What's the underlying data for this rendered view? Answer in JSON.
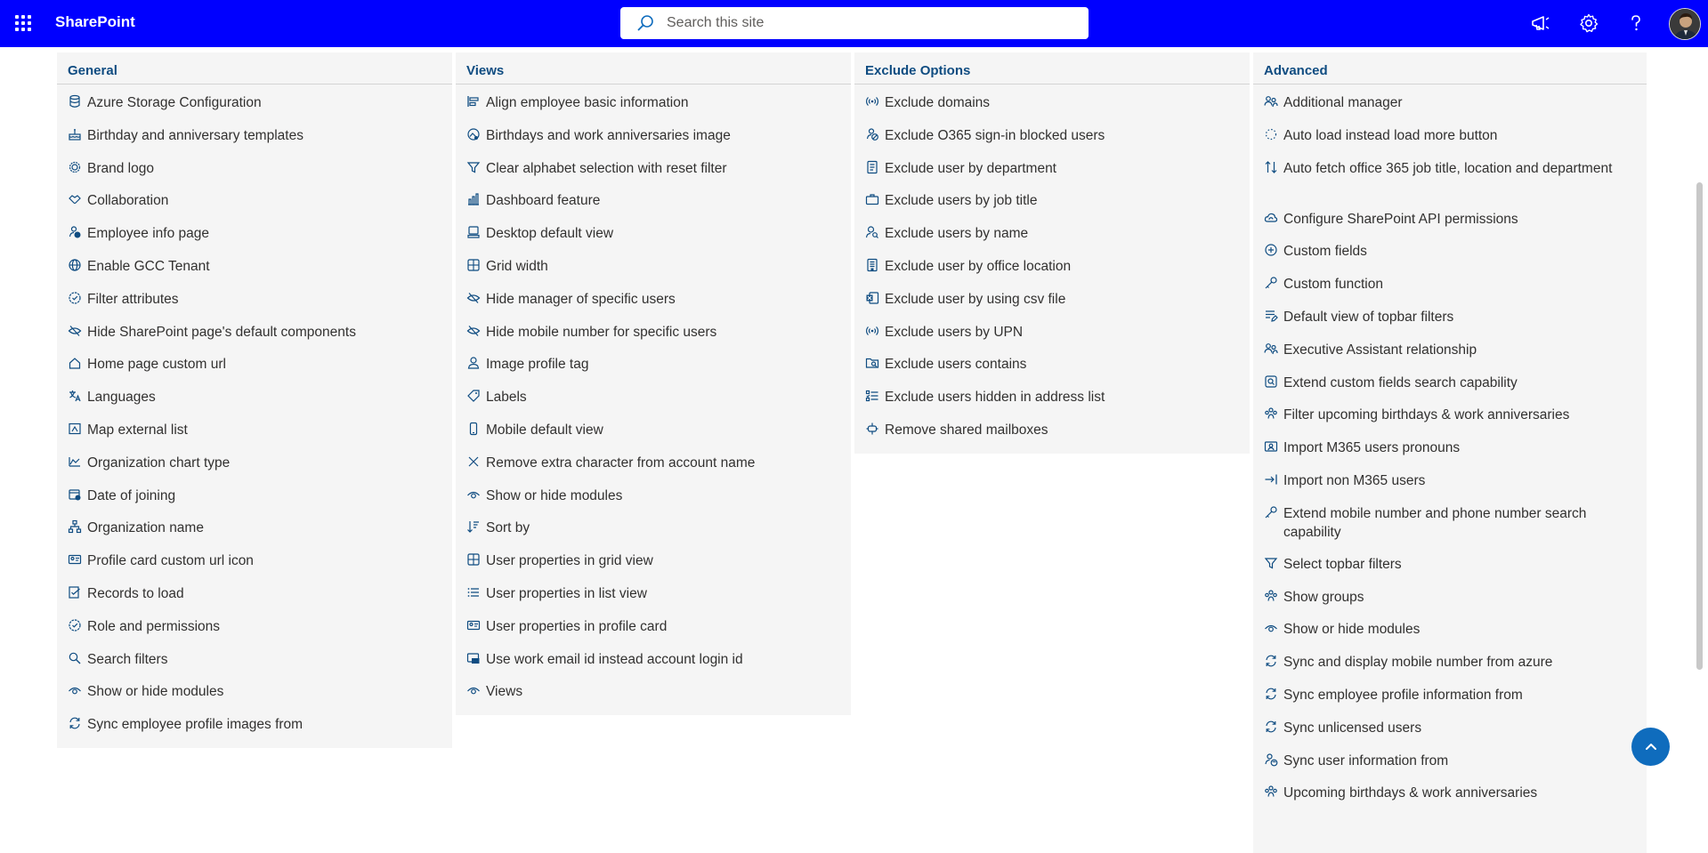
{
  "app": {
    "brand": "SharePoint"
  },
  "search": {
    "placeholder": "Search this site"
  },
  "columns": [
    {
      "title": "General",
      "items": [
        {
          "label": "Azure Storage Configuration",
          "icon": "database-icon"
        },
        {
          "label": "Birthday and anniversary templates",
          "icon": "cake-icon"
        },
        {
          "label": "Brand logo",
          "icon": "badge-icon"
        },
        {
          "label": "Collaboration",
          "icon": "handshake-icon"
        },
        {
          "label": "Employee info page",
          "icon": "person-info-icon"
        },
        {
          "label": "Enable GCC Tenant",
          "icon": "globe-icon"
        },
        {
          "label": "Filter attributes",
          "icon": "badge-check-icon"
        },
        {
          "label": "Hide SharePoint page's default components",
          "icon": "eye-hide-icon"
        },
        {
          "label": "Home page custom url",
          "icon": "home-icon"
        },
        {
          "label": "Languages",
          "icon": "translate-icon"
        },
        {
          "label": "Map external list",
          "icon": "map-list-icon"
        },
        {
          "label": "Organization chart type",
          "icon": "area-chart-icon"
        },
        {
          "label": "Date of joining",
          "icon": "calendar-icon"
        },
        {
          "label": "Organization name",
          "icon": "org-chart-icon"
        },
        {
          "label": "Profile card custom url icon",
          "icon": "contact-card-icon"
        },
        {
          "label": "Records to load",
          "icon": "checklist-icon"
        },
        {
          "label": "Role and permissions",
          "icon": "badge-check-icon"
        },
        {
          "label": "Search filters",
          "icon": "search-icon"
        },
        {
          "label": "Show or hide modules",
          "icon": "eye-icon"
        },
        {
          "label": "Sync employee profile images from",
          "icon": "sync-icon"
        }
      ]
    },
    {
      "title": "Views",
      "items": [
        {
          "label": "Align employee basic information",
          "icon": "align-left-icon"
        },
        {
          "label": "Birthdays and work anniversaries image",
          "icon": "image-icon"
        },
        {
          "label": "Clear alphabet selection with reset filter",
          "icon": "filter-icon"
        },
        {
          "label": "Dashboard feature",
          "icon": "bar-chart-icon"
        },
        {
          "label": "Desktop default view",
          "icon": "desktop-icon"
        },
        {
          "label": "Grid width",
          "icon": "grid-icon"
        },
        {
          "label": "Hide manager of specific users",
          "icon": "eye-hide-icon"
        },
        {
          "label": "Hide mobile number for specific users",
          "icon": "eye-hide-icon"
        },
        {
          "label": "Image profile tag",
          "icon": "person-icon"
        },
        {
          "label": "Labels",
          "icon": "tag-icon"
        },
        {
          "label": "Mobile default view",
          "icon": "mobile-icon"
        },
        {
          "label": "Remove extra character from account name",
          "icon": "close-icon"
        },
        {
          "label": "Show or hide modules",
          "icon": "eye-icon"
        },
        {
          "label": "Sort by",
          "icon": "sort-icon"
        },
        {
          "label": "User properties in grid view",
          "icon": "grid-icon"
        },
        {
          "label": "User properties in list view",
          "icon": "list-icon"
        },
        {
          "label": "User properties in profile card",
          "icon": "contact-card-icon"
        },
        {
          "label": "Use work email id instead account login id",
          "icon": "mail-card-icon"
        },
        {
          "label": "Views",
          "icon": "eye-icon"
        }
      ]
    },
    {
      "title": "Exclude Options",
      "items": [
        {
          "label": "Exclude domains",
          "icon": "broadcast-icon"
        },
        {
          "label": "Exclude O365 sign-in blocked users",
          "icon": "person-blocked-icon"
        },
        {
          "label": "Exclude user by department",
          "icon": "document-icon"
        },
        {
          "label": "Exclude users by job title",
          "icon": "briefcase-icon"
        },
        {
          "label": "Exclude users by name",
          "icon": "person-search-icon"
        },
        {
          "label": "Exclude user by office location",
          "icon": "building-icon"
        },
        {
          "label": "Exclude user by using csv file",
          "icon": "excel-icon"
        },
        {
          "label": "Exclude users by UPN",
          "icon": "broadcast-icon"
        },
        {
          "label": "Exclude users contains",
          "icon": "folder-search-icon"
        },
        {
          "label": "Exclude users hidden in address list",
          "icon": "list-check-icon"
        },
        {
          "label": "Remove shared mailboxes",
          "icon": "plug-icon"
        }
      ]
    },
    {
      "title": "Advanced",
      "items": [
        {
          "label": "Additional manager",
          "icon": "people-icon"
        },
        {
          "label": "Auto load instead load more button",
          "icon": "spinner-icon"
        },
        {
          "label": "Auto fetch office 365 job title, location and department",
          "icon": "arrow-sort-icon"
        },
        {
          "label": "Configure SharePoint API permissions",
          "icon": "cloud-sync-icon"
        },
        {
          "label": "Custom fields",
          "icon": "add-circle-icon"
        },
        {
          "label": "Custom function",
          "icon": "key-icon"
        },
        {
          "label": "Default view of topbar filters",
          "icon": "list-edit-icon"
        },
        {
          "label": "Executive Assistant relationship",
          "icon": "people-icon"
        },
        {
          "label": "Extend custom fields search capability",
          "icon": "search-square-icon"
        },
        {
          "label": "Filter upcoming birthdays & work anniversaries",
          "icon": "people-group-icon"
        },
        {
          "label": "Import M365 users pronouns",
          "icon": "id-card-icon"
        },
        {
          "label": "Import non M365 users",
          "icon": "arrow-import-icon"
        },
        {
          "label": "Extend mobile number and phone number search capability",
          "icon": "key-icon"
        },
        {
          "label": "Select topbar filters",
          "icon": "filter-icon"
        },
        {
          "label": "Show groups",
          "icon": "people-group-icon"
        },
        {
          "label": "Show or hide modules",
          "icon": "eye-icon"
        },
        {
          "label": "Sync and display mobile number from azure",
          "icon": "sync-icon"
        },
        {
          "label": "Sync employee profile information from",
          "icon": "sync-icon"
        },
        {
          "label": "Sync unlicensed users",
          "icon": "sync-icon"
        },
        {
          "label": "Sync user information from",
          "icon": "person-sync-icon"
        },
        {
          "label": "Upcoming birthdays & work anniversaries",
          "icon": "people-group-icon"
        }
      ]
    }
  ],
  "colors": {
    "suite_bar": "#0000ff",
    "heading": "#0f4c81",
    "icon": "#0f4c81",
    "panel": "#f5f5f5",
    "fab": "#0f6cbd"
  }
}
